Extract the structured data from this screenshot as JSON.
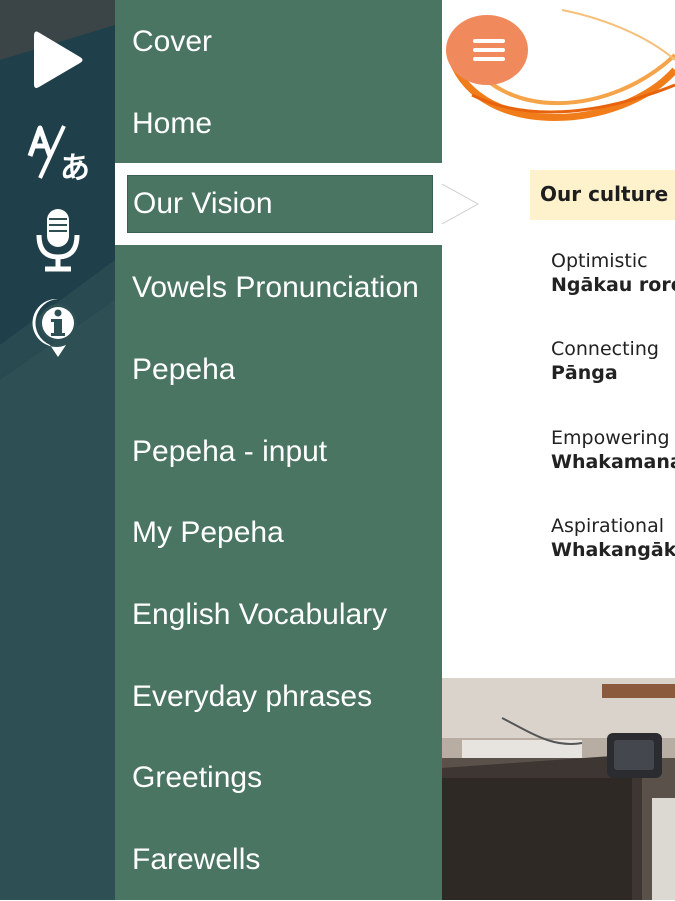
{
  "rail": {
    "icons": [
      "play-icon",
      "translate-icon",
      "microphone-icon",
      "info-icon"
    ]
  },
  "drawer": {
    "items": [
      {
        "label": "Cover",
        "selected": false
      },
      {
        "label": "Home",
        "selected": false
      },
      {
        "label": "Our Vision",
        "selected": true
      },
      {
        "label": "Vowels Pronunciation",
        "selected": false
      },
      {
        "label": "Pepeha",
        "selected": false
      },
      {
        "label": "Pepeha - input",
        "selected": false
      },
      {
        "label": "My Pepeha",
        "selected": false
      },
      {
        "label": "English Vocabulary",
        "selected": false
      },
      {
        "label": "Everyday phrases",
        "selected": false
      },
      {
        "label": "Greetings",
        "selected": false
      },
      {
        "label": "Farewells",
        "selected": false
      }
    ]
  },
  "content": {
    "banner": "Our culture",
    "values": [
      {
        "english": "Optimistic",
        "maori": "Ngākau rorotu"
      },
      {
        "english": "Connecting",
        "maori": "Pānga"
      },
      {
        "english": "Empowering",
        "maori": "Whakamana"
      },
      {
        "english": "Aspirational",
        "maori": "Whakangākau"
      }
    ]
  },
  "colors": {
    "rail": "#2e4f54",
    "drawer": "#4a7563",
    "menu_button": "#f08a5c",
    "banner": "#fdf2cc",
    "logo_arc": "#f07d1a"
  },
  "menu_button_icon": "hamburger-icon"
}
